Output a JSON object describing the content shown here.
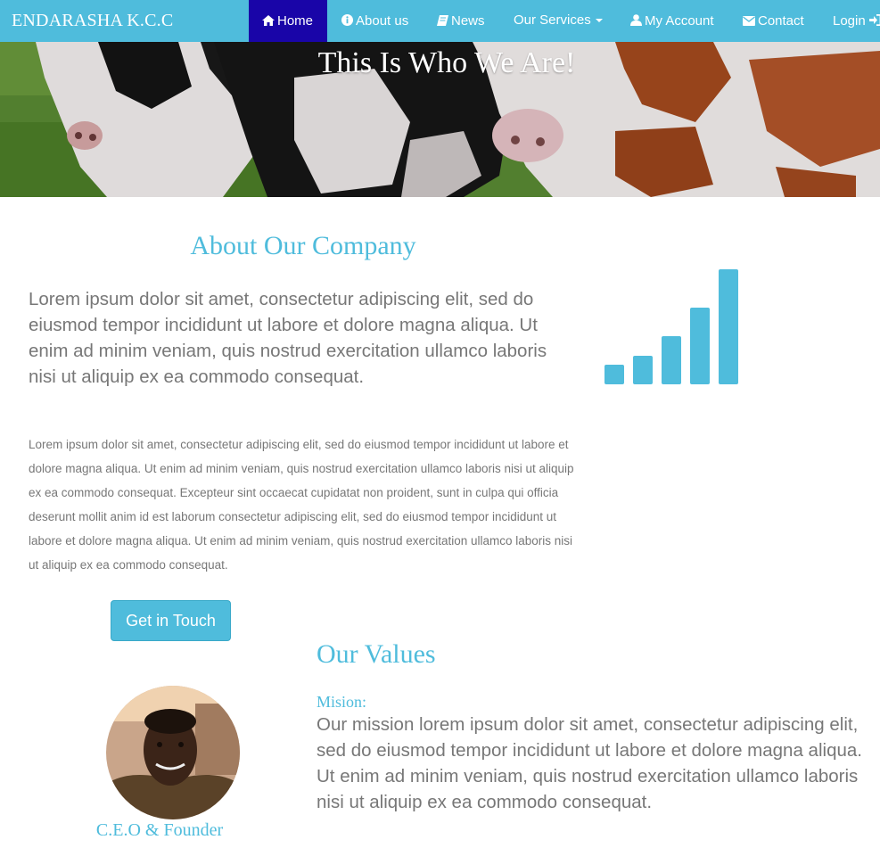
{
  "navbar": {
    "brand": "ENDARASHA K.C.C",
    "items": [
      {
        "label": "Home",
        "icon": "home-icon",
        "active": true
      },
      {
        "label": "About us",
        "icon": "info-icon"
      },
      {
        "label": "News",
        "icon": "book-icon"
      },
      {
        "label": "Our Services",
        "dropdown": true
      },
      {
        "label": "My Account",
        "icon": "user-icon"
      },
      {
        "label": "Contact",
        "icon": "envelope-icon"
      },
      {
        "label": "Login",
        "icon": "login-icon"
      }
    ]
  },
  "hero": {
    "title": "This Is Who We Are!"
  },
  "about": {
    "title": "About Our Company",
    "lead": "Lorem ipsum dolor sit amet, consectetur adipiscing elit, sed do eiusmod tempor incididunt ut labore et dolore magna aliqua. Ut enim ad minim veniam, quis nostrud exercitation ullamco laboris nisi ut aliquip ex ea commodo consequat.",
    "body": "Lorem ipsum dolor sit amet, consectetur adipiscing elit, sed do eiusmod tempor incididunt ut labore et dolore magna aliqua. Ut enim ad minim veniam, quis nostrud exercitation ullamco laboris nisi ut aliquip ex ea commodo consequat. Excepteur sint occaecat cupidatat non proident, sunt in culpa qui officia deserunt mollit anim id est laborum consectetur adipiscing elit, sed do eiusmod tempor incididunt ut labore et dolore magna aliqua. Ut enim ad minim veniam, quis nostrud exercitation ullamco laboris nisi ut aliquip ex ea commodo consequat.",
    "button": "Get in Touch",
    "graphic_icon": "signal-bars-icon"
  },
  "ceo": {
    "caption": "C.E.O & Founder"
  },
  "values": {
    "title": "Our Values",
    "mission_label": "Mision:",
    "mission_text": "Our mission lorem ipsum dolor sit amet, consectetur adipiscing elit, sed do eiusmod tempor incididunt ut labore et dolore magna aliqua. Ut enim ad minim veniam, quis nostrud exercitation ullamco laboris nisi ut aliquip ex ea commodo consequat."
  },
  "colors": {
    "accent": "#4fbcdc",
    "nav_active": "#1905a8",
    "text": "#777777"
  }
}
